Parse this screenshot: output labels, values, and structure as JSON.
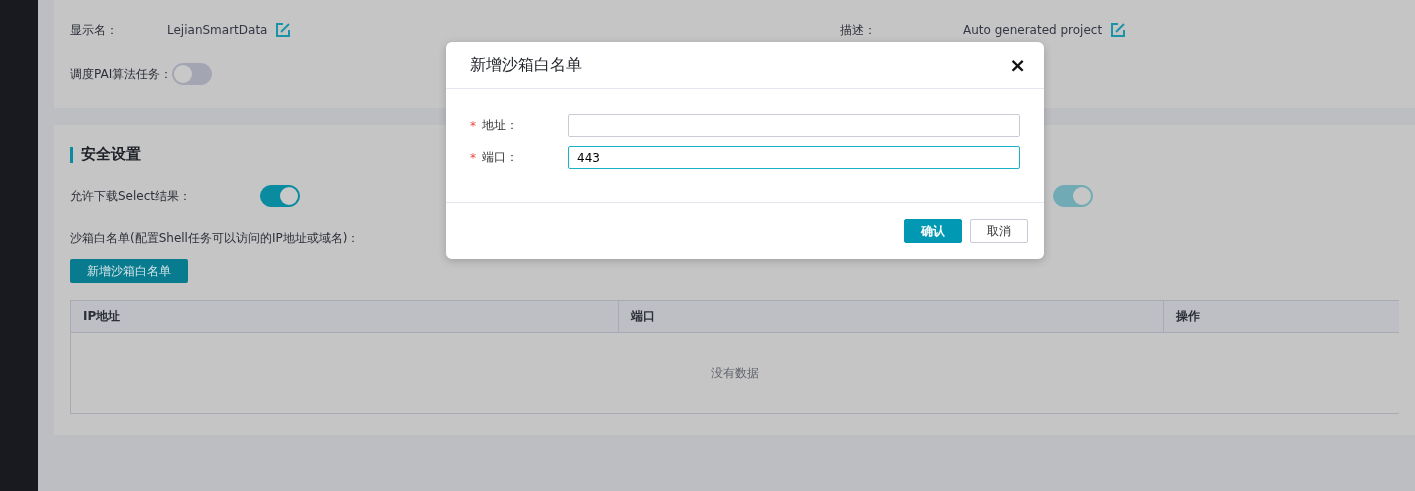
{
  "project_info": {
    "fields": [
      {
        "kind": "editable",
        "label": "显示名：",
        "value": "LejianSmartData"
      },
      {
        "kind": "editable",
        "label": "描述：",
        "value": "Auto generated project"
      },
      {
        "kind": "toggle",
        "label": "调度PAI算法任务：",
        "on": false,
        "disabled": false
      }
    ]
  },
  "security": {
    "title": "安全设置",
    "toggles": [
      {
        "label": "允许下载Select结果：",
        "on": true,
        "disabled": false
      },
      {
        "on": true,
        "disabled": true
      }
    ],
    "whitelist_label": "沙箱白名单(配置Shell任务可以访问的IP地址或域名)：",
    "add_button": "新增沙箱白名单",
    "table": {
      "columns": [
        "IP地址",
        "端口",
        "操作"
      ],
      "empty_text": "没有数据"
    }
  },
  "dialog": {
    "title": "新增沙箱白名单",
    "close": "×",
    "fields": [
      {
        "required_mark": "*",
        "label": "地址：",
        "focused": false
      },
      {
        "required_mark": "*",
        "label": "端口：",
        "value": "443",
        "focused": true
      }
    ],
    "buttons": [
      {
        "label": "确认",
        "kind": "primary"
      },
      {
        "label": "取消",
        "kind": "default"
      }
    ]
  }
}
